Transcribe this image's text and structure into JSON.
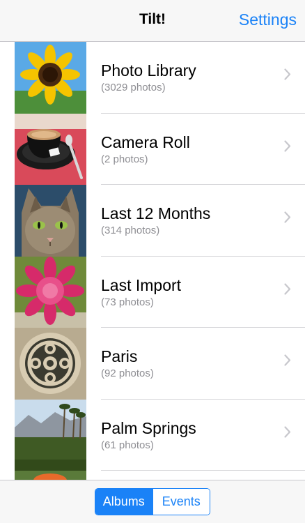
{
  "navbar": {
    "title": "Tilt!",
    "settings_label": "Settings"
  },
  "albums": [
    {
      "title": "Photo Library",
      "count": "(3029 photos)",
      "thumb_icon": "sunflower-thumbnail"
    },
    {
      "title": "Camera Roll",
      "count": "(2 photos)",
      "thumb_icon": "coffee-cup-thumbnail"
    },
    {
      "title": "Last 12 Months",
      "count": "(314 photos)",
      "thumb_icon": "cat-thumbnail"
    },
    {
      "title": "Last Import",
      "count": "(73 photos)",
      "thumb_icon": "dahlia-thumbnail"
    },
    {
      "title": "Paris",
      "count": "(92 photos)",
      "thumb_icon": "gothic-window-thumbnail"
    },
    {
      "title": "Palm Springs",
      "count": "(61 photos)",
      "thumb_icon": "palm-trees-thumbnail"
    }
  ],
  "segmented": {
    "albums_label": "Albums",
    "events_label": "Events",
    "selected": "Albums"
  },
  "colors": {
    "accent": "#1a82f7",
    "secondary_text": "#8e8e93",
    "separator": "#d6d6d9"
  }
}
